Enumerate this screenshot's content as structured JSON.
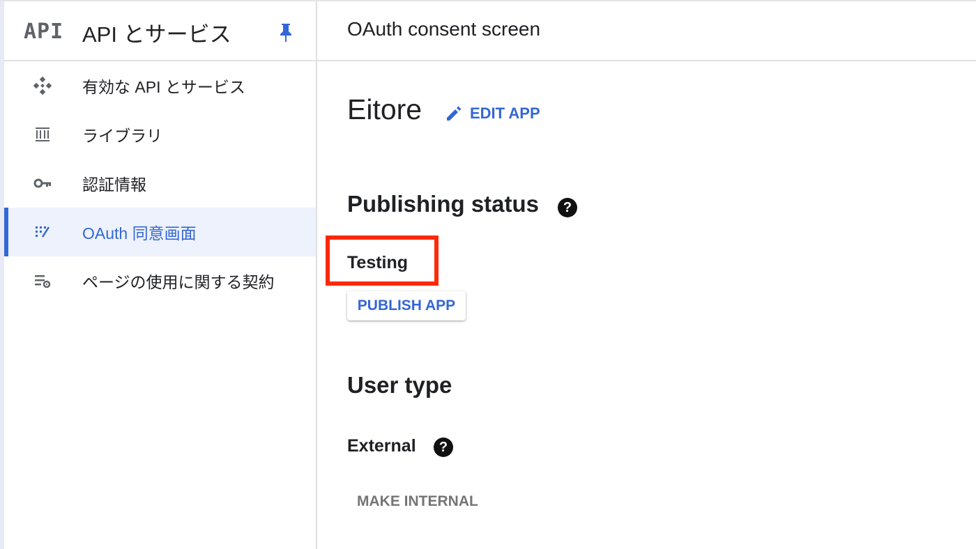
{
  "product": {
    "logo_text": "API",
    "title": "API とサービス"
  },
  "topbar": {
    "title": "OAuth consent screen"
  },
  "sidebar": {
    "items": [
      {
        "label": "有効な API とサービス",
        "icon": "api-diamond-icon",
        "active": false
      },
      {
        "label": "ライブラリ",
        "icon": "library-icon",
        "active": false
      },
      {
        "label": "認証情報",
        "icon": "key-icon",
        "active": false
      },
      {
        "label": "OAuth 同意画面",
        "icon": "oauth-consent-icon",
        "active": true
      },
      {
        "label": "ページの使用に関する契約",
        "icon": "page-settings-icon",
        "active": false
      }
    ]
  },
  "app": {
    "name": "Eitore",
    "edit_label": "EDIT APP"
  },
  "publishing": {
    "heading": "Publishing status",
    "status": "Testing",
    "publish_label": "PUBLISH APP"
  },
  "user_type": {
    "heading": "User type",
    "value": "External",
    "make_internal_label": "MAKE INTERNAL"
  },
  "help_glyph": "?",
  "colors": {
    "accent": "#3367d6",
    "highlight": "#ff2a0a",
    "active_bg": "#eef2fc"
  }
}
